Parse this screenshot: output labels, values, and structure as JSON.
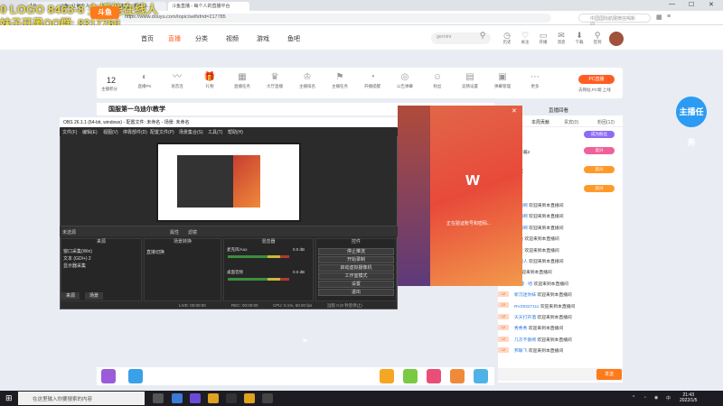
{
  "overlay": {
    "line1": "0 LOGO  8463-8   主播能在线人",
    "line2": "妹子开黑QQ群: 8317760"
  },
  "browser": {
    "tabs": [
      "Lix",
      "斗鱼--让每个人...",
      "小主播、整个斗...",
      "斗鱼直播 - 每个人的直播平台"
    ],
    "url": "https://www.douyu.com/topic/selfsfrid=217785",
    "search_placeholder": "中国国际航展微信喝新闻",
    "back": "←",
    "forward": "→",
    "reload": "⟳",
    "home": "⌂",
    "minimize": "—",
    "maximize": "☐",
    "close": "✕"
  },
  "header": {
    "logo": "斗鱼",
    "nav": [
      "首页",
      "直播",
      "分类",
      "视频",
      "游戏",
      "鱼吧"
    ],
    "search_placeholder": "gemini",
    "icons": [
      {
        "glyph": "◷",
        "label": "历史"
      },
      {
        "glyph": "♡",
        "label": "关注"
      },
      {
        "glyph": "▭",
        "label": "开播"
      },
      {
        "glyph": "✉",
        "label": "消息"
      },
      {
        "glyph": "⬇",
        "label": "下载"
      },
      {
        "glyph": "⚲",
        "label": "签到"
      }
    ]
  },
  "roombar": {
    "level": "12",
    "level_label": "主播积分",
    "items": [
      {
        "glyph": "◐",
        "label": "直播PK"
      },
      {
        "glyph": "〰",
        "label": "语音连"
      },
      {
        "glyph": "🎁",
        "label": "礼物"
      },
      {
        "glyph": "▦",
        "label": "直播任务"
      },
      {
        "glyph": "♛",
        "label": "大厅直播"
      },
      {
        "glyph": "♔",
        "label": "主播排名"
      },
      {
        "glyph": "⚑",
        "label": "主播任务"
      },
      {
        "glyph": "◔",
        "label": "开播提醒"
      },
      {
        "glyph": "◎",
        "label": "公告弹幕"
      },
      {
        "glyph": "☺",
        "label": "粉丝"
      },
      {
        "glyph": "▤",
        "label": "竞猜设置"
      },
      {
        "glyph": "▣",
        "label": "弹幕管理"
      },
      {
        "glyph": "⋯",
        "label": "更多"
      }
    ],
    "pc_button": "PC直播",
    "pc_sub": "去网站,PC端 上线"
  },
  "stream": {
    "title": "国服第一乌迪尔教学",
    "top_gift": "直播回看"
  },
  "right_panel": {
    "tabs": [
      "本周贡献",
      "贵宾(0)",
      "粉团(12)"
    ],
    "task_button": "主播任务",
    "level_items": [
      {
        "name": "弹幕标注",
        "badge": "成为粉丝"
      },
      {
        "name": "可发布鱼子酱2",
        "badge": "高兴"
      },
      {
        "name": "欢迎大神玩",
        "badge": "高兴"
      },
      {
        "name": "吊三...",
        "badge": "高兴"
      }
    ],
    "chat": [
      {
        "user": "鸣鸟拳师的啊",
        "text": "欢迎来到本直播间"
      },
      {
        "user": "南宫小年的啊",
        "text": "欢迎来到本直播间"
      },
      {
        "user": "社恐回嗯的啊",
        "text": "欢迎来到本直播间"
      },
      {
        "user": "相想的兔兔",
        "text": "欢迎来到本直播间"
      },
      {
        "user": "鼠风对牛文",
        "text": "欢迎来到本直播间"
      },
      {
        "user": "可爱乐爱的人",
        "text": "欢迎来到本直播间"
      },
      {
        "user": "ZHNI老",
        "text": "欢迎来到本直播间"
      },
      {
        "user": "I love I 嘟嘟 · 哈",
        "text": "欢迎来到本直播间"
      },
      {
        "user": "新沉迷你妹",
        "text": "欢迎来到本直播间"
      },
      {
        "user": "RVZ9327111",
        "text": "欢迎来到本直播间"
      },
      {
        "user": "天天打开酒",
        "text": "欢迎来到本直播间"
      },
      {
        "user": "秀秀秀",
        "text": "欢迎来到本直播间"
      },
      {
        "user": "几次不傲啊",
        "text": "欢迎来到本直播间"
      },
      {
        "user": "邦联飞",
        "text": "欢迎来到本直播间"
      }
    ],
    "badges": [
      "12",
      "12",
      "12",
      "12",
      "12",
      "12"
    ],
    "send": "发送"
  },
  "obs": {
    "title": "OBS 26.1.1 (64-bit, windows) - 配置文件: 未命名 - 场景: 未命名",
    "menu": [
      "文件(F)",
      "编辑(E)",
      "视图(V)",
      "停靠部件(D)",
      "配置文件(P)",
      "场景集合(S)",
      "工具(T)",
      "帮助(H)"
    ],
    "strip_label": "未选源",
    "strip_buttons": [
      "属性",
      "滤镜"
    ],
    "dock_headers": [
      "来源",
      "场景转换",
      "混音器",
      "控件"
    ],
    "sources": [
      "窗口采集(Win)",
      "文本 (GDI+) 2",
      "显示器采集"
    ],
    "transition": "直接切换",
    "mixer": [
      {
        "name": "麦克风/Aux",
        "level": "0.0 dB"
      },
      {
        "name": "桌面音频",
        "level": "0.0 dB"
      }
    ],
    "controls": [
      "停止推流",
      "开始录制",
      "启动虚拟摄像机",
      "工作室模式",
      "设置",
      "退出"
    ],
    "bottom_tabs": [
      "来源",
      "场景"
    ],
    "status": {
      "live": "LIVE: 00:00:00",
      "rec": "REC: 00:00:00",
      "cpu": "CPU: 0.1%, 60.00 fps",
      "kb": "远程 0 (0 秒后停止)"
    }
  },
  "loading": {
    "text": "正在验证账号和密码...",
    "close": "✕",
    "logo": "ᴡ"
  },
  "taskbar": {
    "search_placeholder": "在这里输入你要搜索的内容",
    "time": "21:43",
    "date": "2022/1/5",
    "tray": [
      "^",
      "ENG",
      "中"
    ]
  },
  "colors": {
    "brand": "#ff5d23",
    "obs_bg": "#2b2b2b"
  }
}
